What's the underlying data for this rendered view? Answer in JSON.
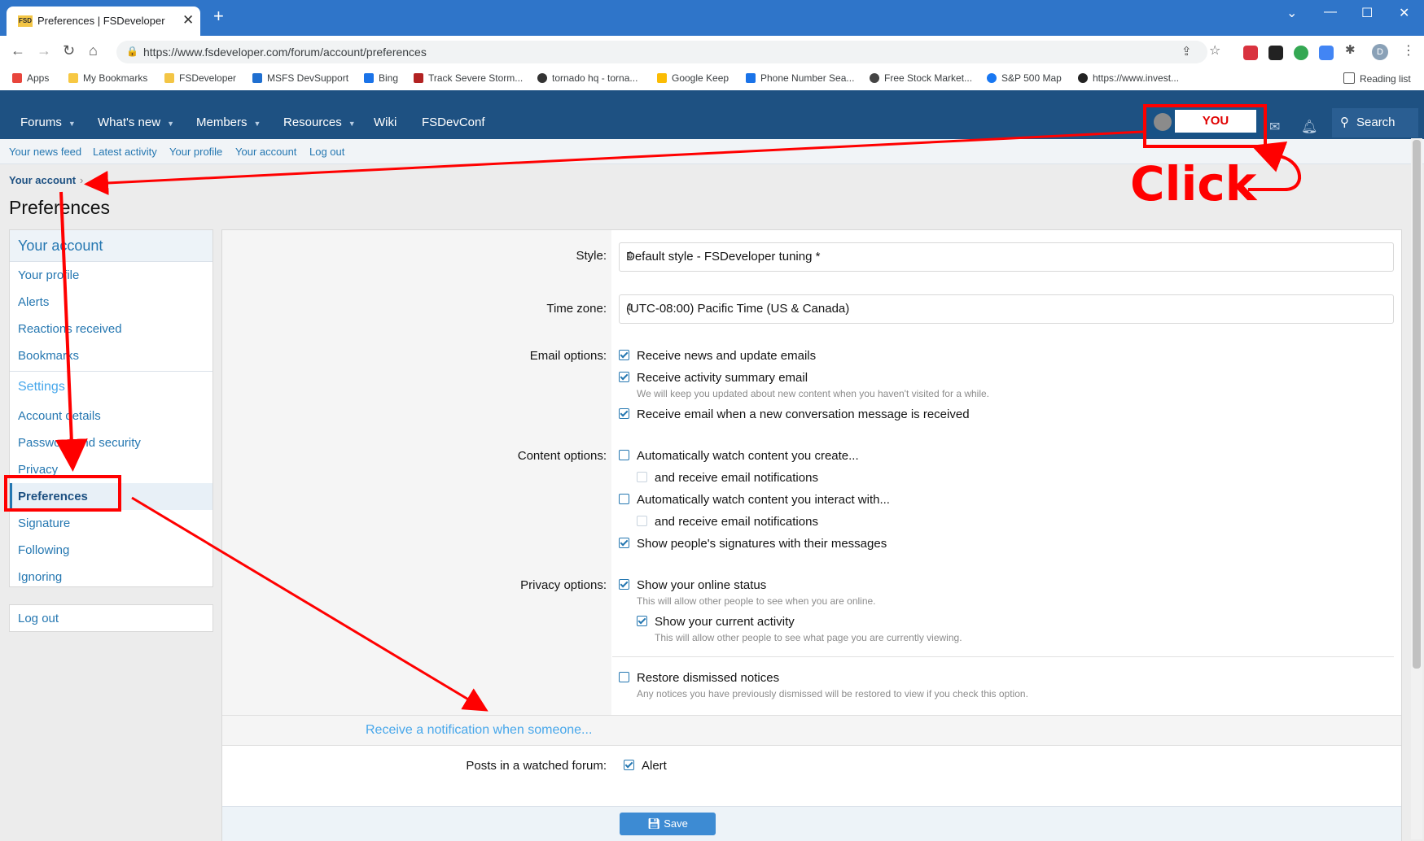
{
  "browser": {
    "tab_title": "Preferences | FSDeveloper",
    "tab_favicon_text": "FSD",
    "url": "https://www.fsdeveloper.com/forum/account/preferences",
    "profile_letter": "D",
    "reading_list": "Reading list",
    "bookmarks": [
      "Apps",
      "My Bookmarks",
      "FSDeveloper",
      "MSFS DevSupport",
      "Bing",
      "Track Severe Storm...",
      "tornado hq - torna...",
      "Google Keep",
      "Phone Number Sea...",
      "Free Stock Market...",
      "S&P 500 Map",
      "https://www.invest..."
    ]
  },
  "site": {
    "nav": [
      "Forums",
      "What's new",
      "Members",
      "Resources",
      "Wiki",
      "FSDevConf"
    ],
    "user_label": "YOU",
    "search": "Search",
    "subnav": [
      "Your news feed",
      "Latest activity",
      "Your profile",
      "Your account",
      "Log out"
    ]
  },
  "breadcrumb": "Your account",
  "page_title": "Preferences",
  "sidebar": {
    "account_head": "Your account",
    "account_items": [
      "Your profile",
      "Alerts",
      "Reactions received",
      "Bookmarks"
    ],
    "settings_head": "Settings",
    "settings_items": [
      "Account details",
      "Password and security",
      "Privacy",
      "Preferences",
      "Signature",
      "Following",
      "Ignoring"
    ],
    "logout": "Log out"
  },
  "form": {
    "style_label": "Style:",
    "style_value": "Default style - FSDeveloper tuning *",
    "timezone_label": "Time zone:",
    "timezone_value": "(UTC-08:00) Pacific Time (US & Canada)",
    "email_label": "Email options:",
    "email_opt1": "Receive news and update emails",
    "email_opt2": "Receive activity summary email",
    "email_opt2_hint": "We will keep you updated about new content when you haven't visited for a while.",
    "email_opt3": "Receive email when a new conversation message is received",
    "content_label": "Content options:",
    "content_opt1": "Automatically watch content you create...",
    "content_opt1_sub": "and receive email notifications",
    "content_opt2": "Automatically watch content you interact with...",
    "content_opt2_sub": "and receive email notifications",
    "content_opt3": "Show people's signatures with their messages",
    "privacy_label": "Privacy options:",
    "privacy_opt1": "Show your online status",
    "privacy_opt1_hint": "This will allow other people to see when you are online.",
    "privacy_opt2": "Show your current activity",
    "privacy_opt2_hint": "This will allow other people to see what page you are currently viewing.",
    "restore_opt": "Restore dismissed notices",
    "restore_hint": "Any notices you have previously dismissed will be restored to view if you check this option.",
    "section_head": "Receive a notification when someone...",
    "watched_forum_label": "Posts in a watched forum:",
    "alert": "Alert",
    "save": "Save"
  },
  "annotation": {
    "click_text": "Click",
    "color": "#ff0000"
  }
}
